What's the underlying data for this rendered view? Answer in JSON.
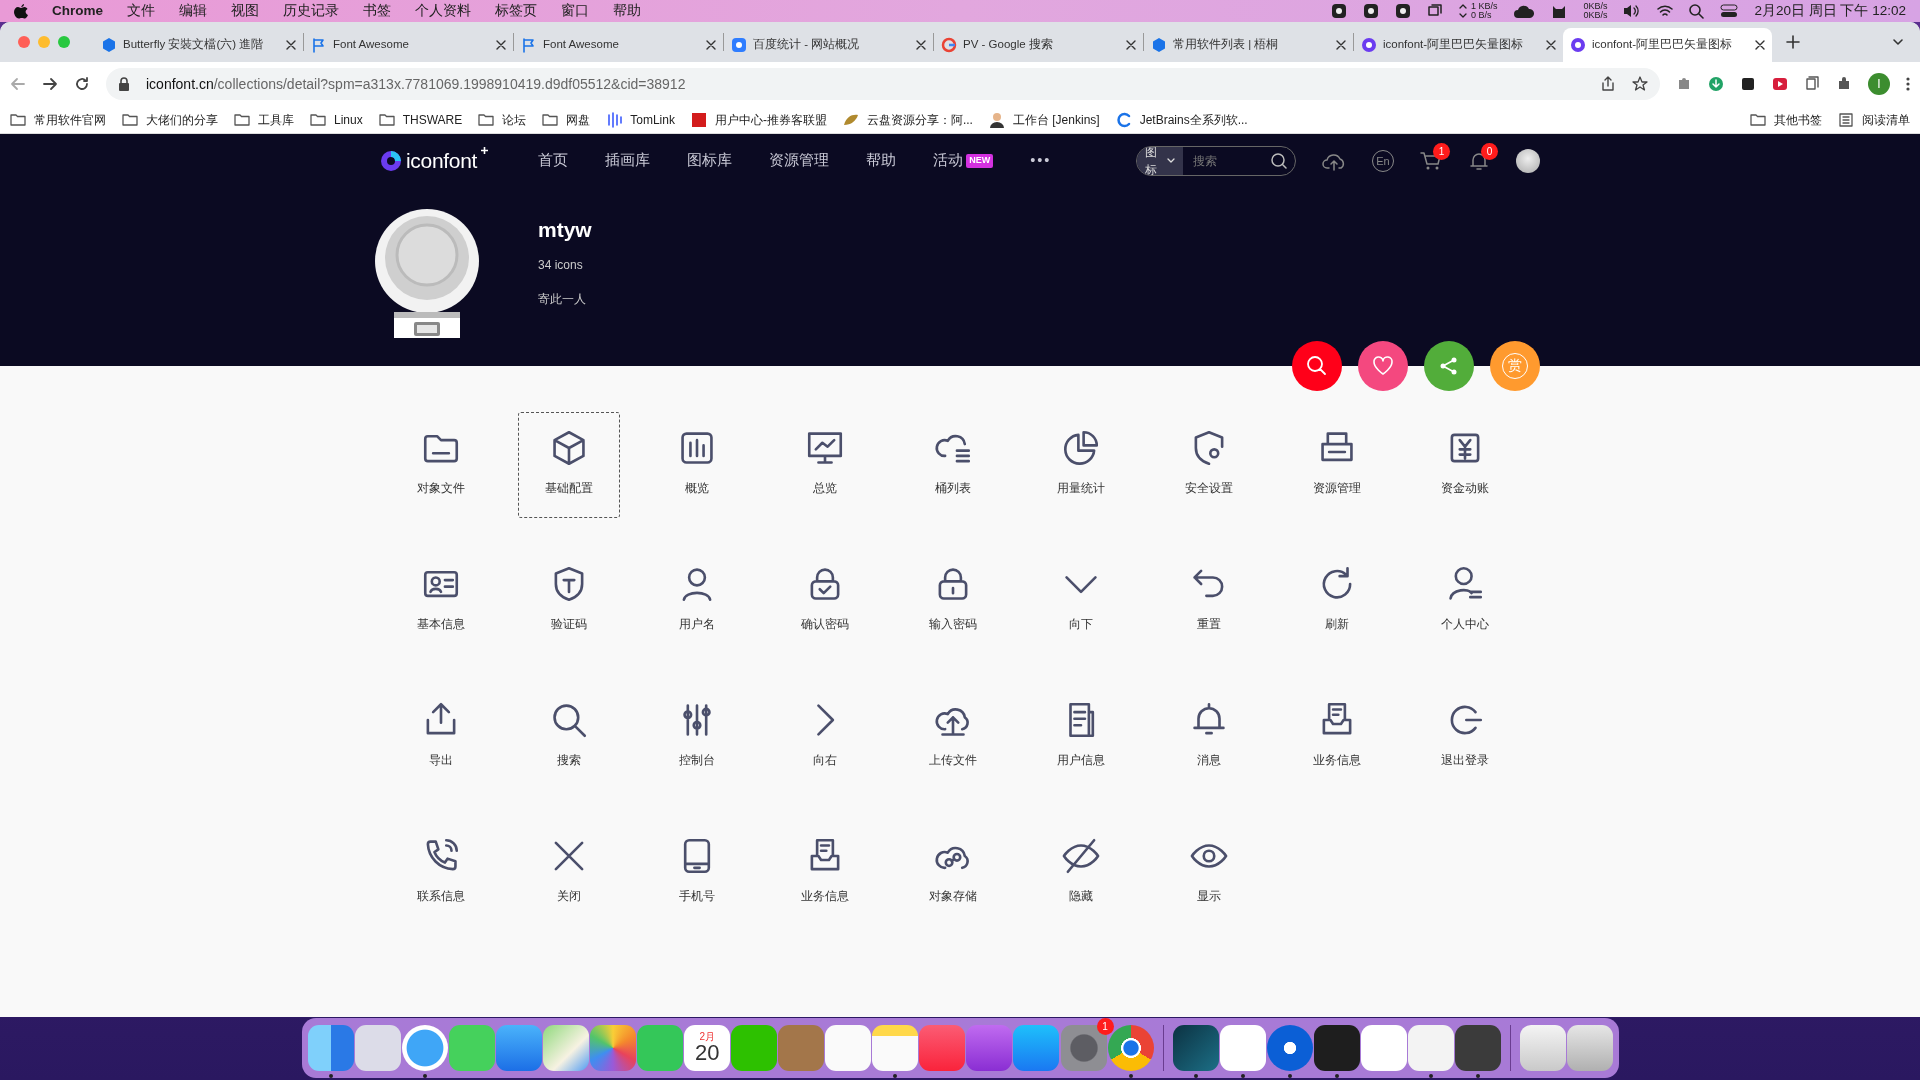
{
  "menubar": {
    "app": "Chrome",
    "items": [
      "文件",
      "编辑",
      "视图",
      "历史记录",
      "书签",
      "个人资料",
      "标签页",
      "窗口",
      "帮助"
    ],
    "net_up": "1 KB/s",
    "net_down": "0 B/s",
    "net_in": "0KB/s",
    "net_out": "0KB/s",
    "clock": "2月20日 周日 下午 12:02"
  },
  "tabs": [
    {
      "title": "Butterfly 安裝文檔(六) 進階",
      "kind": "hexagon",
      "selected": false
    },
    {
      "title": "Font Awesome",
      "kind": "flag",
      "selected": false
    },
    {
      "title": "Font Awesome",
      "kind": "flag",
      "selected": false
    },
    {
      "title": "百度统计 - 网站概况",
      "kind": "square",
      "selected": false
    },
    {
      "title": "PV - Google 搜索",
      "kind": "g",
      "selected": false
    },
    {
      "title": "常用软件列表 | 梧桐",
      "kind": "hexagon",
      "selected": false
    },
    {
      "title": "iconfont-阿里巴巴矢量图标",
      "kind": "swirl",
      "selected": false
    },
    {
      "title": "iconfont-阿里巴巴矢量图标",
      "kind": "swirl",
      "selected": true
    }
  ],
  "address": {
    "host": "iconfont.cn",
    "path": "/collections/detail?spm=a313x.7781069.1998910419.d9df05512&cid=38912"
  },
  "profile_initial": "I",
  "bookmarks": [
    {
      "title": "常用软件官网",
      "kind": "folder"
    },
    {
      "title": "大佬们的分享",
      "kind": "folder"
    },
    {
      "title": "工具库",
      "kind": "folder"
    },
    {
      "title": "Linux",
      "kind": "folder"
    },
    {
      "title": "THSWARE",
      "kind": "folder"
    },
    {
      "title": "论坛",
      "kind": "folder"
    },
    {
      "title": "网盘",
      "kind": "folder"
    },
    {
      "title": "TomLink",
      "kind": "bars"
    },
    {
      "title": "用户中心-推券客联盟",
      "kind": "redsquare"
    },
    {
      "title": "云盘资源分享：阿...",
      "kind": "leaf"
    },
    {
      "title": "工作台 [Jenkins]",
      "kind": "person"
    },
    {
      "title": "JetBrains全系列软...",
      "kind": "arc"
    }
  ],
  "bookmarks_right": [
    {
      "title": "其他书签",
      "kind": "folder"
    },
    {
      "title": "阅读清单",
      "kind": "list"
    }
  ],
  "site": {
    "logo": "iconfont",
    "nav": [
      {
        "label": "首页"
      },
      {
        "label": "插画库"
      },
      {
        "label": "图标库"
      },
      {
        "label": "资源管理"
      },
      {
        "label": "帮助"
      },
      {
        "label": "活动",
        "badge": "NEW"
      }
    ],
    "more": "•••",
    "search_type": "图标",
    "search_placeholder": "搜索",
    "lang": "En",
    "cart_count": "1",
    "notice_count": "0"
  },
  "profile": {
    "name": "mtyw",
    "count": "34 icons",
    "bio": "寄此一人"
  },
  "actions": [
    {
      "kind": "search",
      "color": "#ff0019"
    },
    {
      "kind": "heart",
      "color": "#f4487f"
    },
    {
      "kind": "share",
      "color": "#52ad3a"
    },
    {
      "kind": "reward",
      "color": "#ff9a2e",
      "text": "赏"
    }
  ],
  "icons": [
    {
      "label": "对象文件",
      "selected": false
    },
    {
      "label": "基础配置",
      "selected": true
    },
    {
      "label": "概览",
      "selected": false
    },
    {
      "label": "总览",
      "selected": false
    },
    {
      "label": "桶列表",
      "selected": false
    },
    {
      "label": "用量统计",
      "selected": false
    },
    {
      "label": "安全设置",
      "selected": false
    },
    {
      "label": "资源管理",
      "selected": false
    },
    {
      "label": "资金动账",
      "selected": false
    },
    {
      "label": "基本信息",
      "selected": false
    },
    {
      "label": "验证码",
      "selected": false
    },
    {
      "label": "用户名",
      "selected": false
    },
    {
      "label": "确认密码",
      "selected": false
    },
    {
      "label": "输入密码",
      "selected": false
    },
    {
      "label": "向下",
      "selected": false
    },
    {
      "label": "重置",
      "selected": false
    },
    {
      "label": "刷新",
      "selected": false
    },
    {
      "label": "个人中心",
      "selected": false
    },
    {
      "label": "导出",
      "selected": false
    },
    {
      "label": "搜索",
      "selected": false
    },
    {
      "label": "控制台",
      "selected": false
    },
    {
      "label": "向右",
      "selected": false
    },
    {
      "label": "上传文件",
      "selected": false
    },
    {
      "label": "用户信息",
      "selected": false
    },
    {
      "label": "消息",
      "selected": false
    },
    {
      "label": "业务信息",
      "selected": false
    },
    {
      "label": "退出登录",
      "selected": false
    },
    {
      "label": "联系信息",
      "selected": false
    },
    {
      "label": "关闭",
      "selected": false
    },
    {
      "label": "手机号",
      "selected": false
    },
    {
      "label": "业务信息",
      "selected": false
    },
    {
      "label": "对象存储",
      "selected": false
    },
    {
      "label": "隐藏",
      "selected": false
    },
    {
      "label": "显示",
      "selected": false
    }
  ],
  "dock": [
    {
      "kind": "finder",
      "running": true
    },
    {
      "kind": "launchpad",
      "running": false
    },
    {
      "kind": "safari",
      "running": true
    },
    {
      "kind": "messages",
      "running": false
    },
    {
      "kind": "mail",
      "running": false
    },
    {
      "kind": "maps",
      "running": false
    },
    {
      "kind": "photos",
      "running": false
    },
    {
      "kind": "facetime",
      "running": false
    },
    {
      "kind": "calendar",
      "running": false,
      "month": "2月",
      "day": "20"
    },
    {
      "kind": "wechat",
      "running": false
    },
    {
      "kind": "contacts",
      "running": false
    },
    {
      "kind": "reminders",
      "running": false
    },
    {
      "kind": "notes",
      "running": true
    },
    {
      "kind": "music",
      "running": false
    },
    {
      "kind": "podcasts",
      "running": false
    },
    {
      "kind": "appstore",
      "running": false
    },
    {
      "kind": "settings",
      "running": false,
      "badge": "1"
    },
    {
      "kind": "chrome",
      "running": true
    },
    {
      "kind": "divider"
    },
    {
      "kind": "teal",
      "running": true
    },
    {
      "kind": "whiteblue",
      "running": true
    },
    {
      "kind": "bluecircle",
      "running": true
    },
    {
      "kind": "terminal",
      "running": true
    },
    {
      "kind": "code",
      "running": false
    },
    {
      "kind": "typora",
      "running": true
    },
    {
      "kind": "darkapp",
      "running": true
    },
    {
      "kind": "divider"
    },
    {
      "kind": "document",
      "running": false
    },
    {
      "kind": "trash",
      "running": false
    }
  ]
}
